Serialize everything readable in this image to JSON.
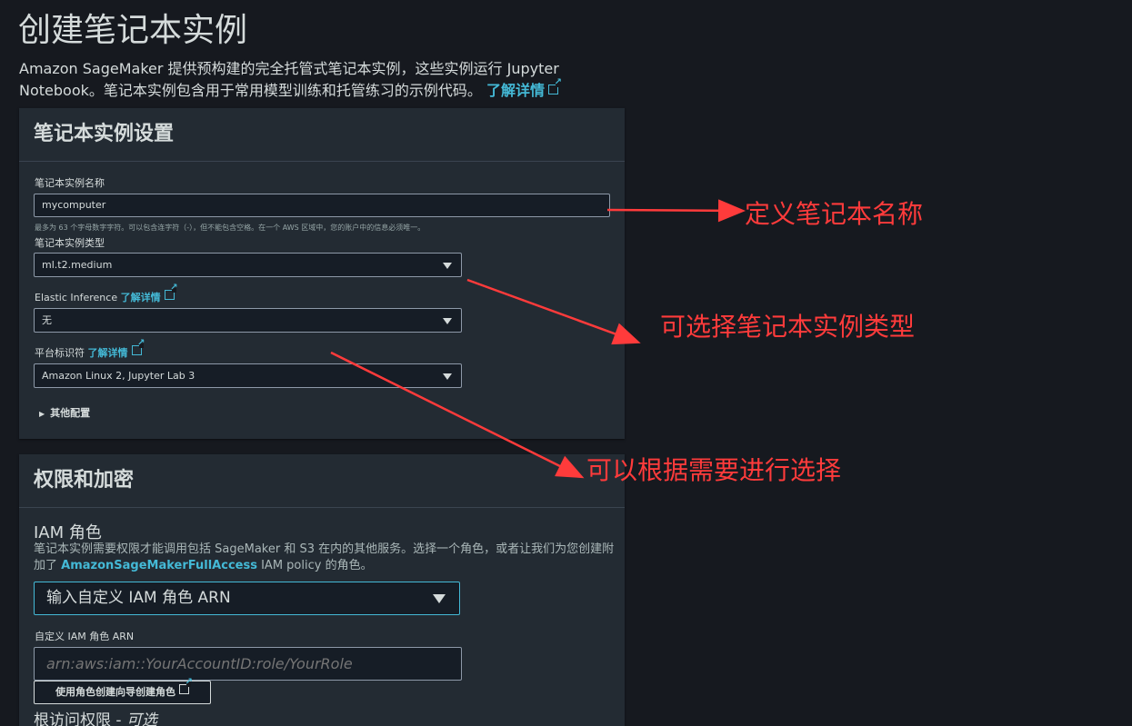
{
  "page": {
    "title": "创建笔记本实例",
    "intro": "Amazon SageMaker 提供预构建的完全托管式笔记本实例，这些实例运行 Jupyter Notebook。笔记本实例包含用于常用模型训练和托管练习的示例代码。",
    "intro_link": "了解详情"
  },
  "settings_panel": {
    "heading": "笔记本实例设置",
    "name_label": "笔记本实例名称",
    "name_value": "mycomputer",
    "name_hint": "最多为 63 个字母数字字符。可以包含连字符（-），但不能包含空格。在一个 AWS 区域中，您的账户中的信息必须唯一。",
    "type_label": "笔记本实例类型",
    "type_value": "ml.t2.medium",
    "ei_label": "Elastic Inference",
    "ei_link": "了解详情",
    "ei_value": "无",
    "platform_label": "平台标识符",
    "platform_link": "了解详情",
    "platform_value": "Amazon Linux 2, Jupyter Lab 3",
    "other_config": "其他配置"
  },
  "permissions_panel": {
    "heading": "权限和加密",
    "iam_role_label": "IAM 角色",
    "iam_desc_1": "笔记本实例需要权限才能调用包括 SageMaker 和 S3 在内的其他服务。选择一个角色，或者让我们为您创建附加了",
    "iam_desc_link": "AmazonSageMakerFullAccess",
    "iam_desc_2": "IAM policy 的角色。",
    "iam_select_value": "输入自定义 IAM 角色 ARN",
    "custom_arn_label": "自定义 IAM 角色 ARN",
    "custom_arn_placeholder": "arn:aws:iam::YourAccountID:role/YourRole",
    "create_role_button": "使用角色创建向导创建角色",
    "root_access_label": "根访问权限 - ",
    "root_access_optional": "可选"
  },
  "annotations": {
    "name": "定义笔记本名称",
    "type": "可选择笔记本实例类型",
    "choose": "可以根据需要进行选择",
    "color": "#ff3b3b"
  },
  "colors": {
    "background": "#16191f",
    "panel": "#232b33",
    "link": "#44b9d6"
  }
}
